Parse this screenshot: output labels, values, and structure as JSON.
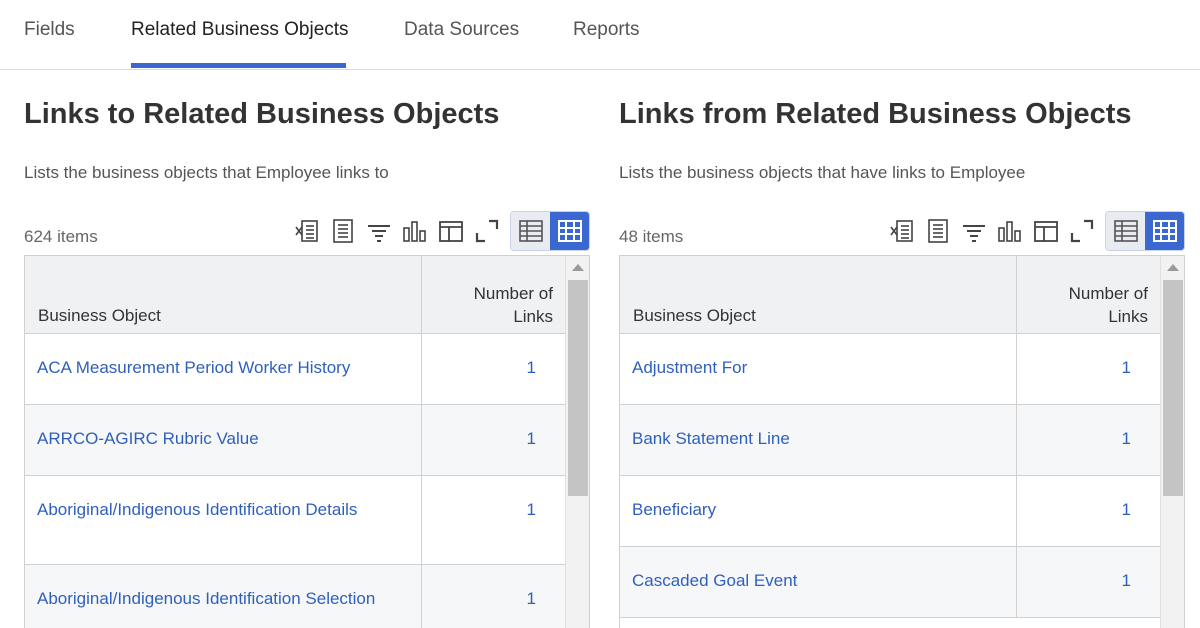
{
  "tabs": [
    {
      "label": "Fields",
      "active": false
    },
    {
      "label": "Related Business Objects",
      "active": true
    },
    {
      "label": "Data Sources",
      "active": false
    },
    {
      "label": "Reports",
      "active": false
    }
  ],
  "colors": {
    "accent": "#3b67d1",
    "link": "#2f5fbd"
  },
  "left_panel": {
    "title": "Links to Related Business Objects",
    "description": "Lists the business objects that Employee links to",
    "item_count": "624 items",
    "columns": {
      "object": "Business Object",
      "num_line1": "Number of",
      "num_line2": "Links"
    },
    "rows": [
      {
        "object": "ACA Measurement Period Worker History",
        "count": "1"
      },
      {
        "object": "ARRCO-AGIRC Rubric Value",
        "count": "1"
      },
      {
        "object": "Aboriginal/Indigenous Identification Details",
        "count": "1"
      },
      {
        "object": "Aboriginal/Indigenous Identification Selection",
        "count": "1"
      }
    ]
  },
  "right_panel": {
    "title": "Links from Related Business Objects",
    "description": "Lists the business objects that have links to Employee",
    "item_count": "48 items",
    "columns": {
      "object": "Business Object",
      "num_line1": "Number of",
      "num_line2": "Links"
    },
    "rows": [
      {
        "object": "Adjustment For",
        "count": "1"
      },
      {
        "object": "Bank Statement Line",
        "count": "1"
      },
      {
        "object": "Beneficiary",
        "count": "1"
      },
      {
        "object": "Cascaded Goal Event",
        "count": "1"
      }
    ]
  },
  "toolbar_icons": [
    "export-excel-icon",
    "export-pdf-icon",
    "filter-icon",
    "chart-icon",
    "columns-icon",
    "fullscreen-icon"
  ],
  "view_modes": [
    "table-view-icon",
    "grid-view-icon"
  ]
}
